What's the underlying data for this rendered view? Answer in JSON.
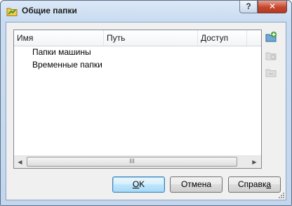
{
  "window": {
    "title": "Общие папки",
    "help_button": "?",
    "close_button": "✕"
  },
  "list": {
    "columns": [
      "Имя",
      "Путь",
      "Доступ"
    ],
    "items": [
      {
        "label": "Папки машины"
      },
      {
        "label": "Временные папки"
      }
    ],
    "scroll_grip": "III"
  },
  "side_buttons": [
    {
      "name": "add-folder-button",
      "icon": "folder-add-icon",
      "enabled": true
    },
    {
      "name": "edit-folder-button",
      "icon": "folder-edit-icon",
      "enabled": false
    },
    {
      "name": "remove-folder-button",
      "icon": "folder-remove-icon",
      "enabled": false
    }
  ],
  "buttons": {
    "ok": {
      "accel": "O",
      "rest": "K"
    },
    "cancel": "Отмена",
    "help": {
      "pre": "Справк",
      "accel": "а"
    }
  },
  "colors": {
    "accent": "#3c7fb1",
    "close": "#c8452b",
    "icon_green": "#3e9a2a"
  }
}
